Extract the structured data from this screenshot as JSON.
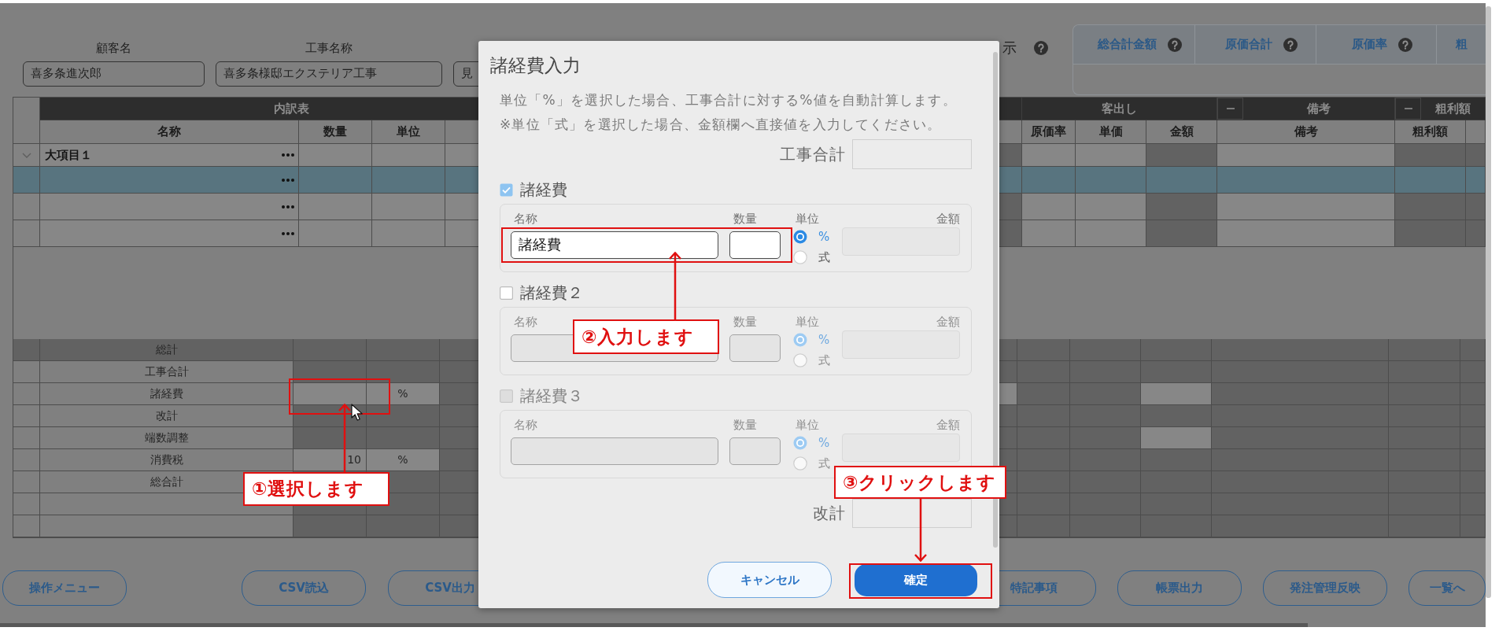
{
  "form": {
    "fields": [
      {
        "label": "顧客名",
        "value": "喜多条進次郎"
      },
      {
        "label": "工事名称",
        "value": "喜多条様邸エクステリア工事"
      },
      {
        "value": "見"
      }
    ],
    "partial_label": "示"
  },
  "summary_panel": {
    "columns": [
      {
        "label": "総合計金額",
        "help": true
      },
      {
        "label": "原価合計",
        "help": true
      },
      {
        "label": "原価率",
        "help": true
      },
      {
        "label": "粗",
        "help": false
      }
    ]
  },
  "table": {
    "column_groups": [
      {
        "label": "内訳表",
        "collapsible": false
      },
      {
        "label": "客出し",
        "collapsible": false
      },
      {
        "label": "備考",
        "collapsible": true,
        "expanded": true
      },
      {
        "label": "粗利額",
        "collapsible": true,
        "expanded": true
      }
    ],
    "columns": [
      {
        "label": "名称",
        "readonly": false
      },
      {
        "label": "数量",
        "readonly": false
      },
      {
        "label": "単位",
        "readonly": false
      },
      {
        "readonly": false
      },
      {
        "readonly": true
      },
      {
        "label": "原価率",
        "readonly": false
      },
      {
        "label": "単価",
        "readonly": false
      },
      {
        "label": "金額",
        "readonly": true
      },
      {
        "label": "備考",
        "readonly": false
      },
      {
        "label": "粗利額",
        "readonly": true
      },
      {
        "readonly": true
      }
    ],
    "rows": [
      {
        "kind": "group",
        "name": "大項目１",
        "expanded": true,
        "selected": false
      },
      {
        "kind": "item",
        "selected": true
      },
      {
        "kind": "item",
        "selected": false
      },
      {
        "kind": "item",
        "selected": false
      }
    ]
  },
  "summary": {
    "rows": [
      {
        "label": "総計",
        "kind": "heading",
        "cells": [
          {
            "editable": false
          },
          {
            "editable": false
          },
          {
            "editable": false
          },
          {
            "editable": false
          },
          {
            "editable": false
          },
          {
            "editable": false
          },
          {
            "editable": false
          },
          {
            "editable": false
          },
          {
            "editable": false
          },
          {
            "editable": false
          }
        ]
      },
      {
        "label": "工事合計",
        "kind": "line",
        "cells": [
          {
            "editable": false
          },
          {
            "editable": false
          },
          {
            "editable": false
          },
          {
            "editable": false
          },
          {
            "editable": false
          },
          {
            "editable": false
          },
          {
            "editable": false
          },
          {
            "editable": false
          },
          {
            "editable": false
          },
          {
            "editable": false
          }
        ]
      },
      {
        "label": "諸経費",
        "kind": "line",
        "cells": [
          {
            "editable": true
          },
          {
            "editable": true,
            "text": "%"
          },
          {
            "editable": false
          },
          {
            "editable": true
          },
          {
            "editable": false
          },
          {
            "editable": false
          },
          {
            "editable": true
          },
          {
            "editable": false
          },
          {
            "editable": false
          },
          {
            "editable": false
          }
        ]
      },
      {
        "label": "改計",
        "kind": "line",
        "cells": [
          {
            "editable": false
          },
          {
            "editable": false
          },
          {
            "editable": false
          },
          {
            "editable": false
          },
          {
            "editable": false
          },
          {
            "editable": false
          },
          {
            "editable": false
          },
          {
            "editable": false
          },
          {
            "editable": false
          },
          {
            "editable": false
          }
        ]
      },
      {
        "label": "端数調整",
        "kind": "line",
        "cells": [
          {
            "editable": false
          },
          {
            "editable": false
          },
          {
            "editable": false
          },
          {
            "editable": false
          },
          {
            "editable": false
          },
          {
            "editable": false
          },
          {
            "editable": true
          },
          {
            "editable": false
          },
          {
            "editable": false
          },
          {
            "editable": false
          }
        ]
      },
      {
        "label": "消費税",
        "kind": "line",
        "cells": [
          {
            "editable": true,
            "text": "10"
          },
          {
            "editable": true,
            "text": "%"
          },
          {
            "editable": false
          },
          {
            "editable": false
          },
          {
            "editable": false
          },
          {
            "editable": false
          },
          {
            "editable": false
          },
          {
            "editable": false
          },
          {
            "editable": false
          },
          {
            "editable": false
          }
        ]
      },
      {
        "label": "総合計",
        "kind": "line",
        "cells": [
          {
            "editable": false
          },
          {
            "editable": false
          },
          {
            "editable": false
          },
          {
            "editable": false
          },
          {
            "editable": false
          },
          {
            "editable": false
          },
          {
            "editable": false
          },
          {
            "editable": false
          },
          {
            "editable": false
          },
          {
            "editable": false
          }
        ]
      },
      {
        "kind": "line",
        "cells": [
          {
            "editable": false
          },
          {
            "editable": false
          },
          {
            "editable": false
          },
          {
            "editable": false
          },
          {
            "editable": false
          },
          {
            "editable": false
          },
          {
            "editable": false
          },
          {
            "editable": false
          },
          {
            "editable": false
          },
          {
            "editable": false
          }
        ]
      },
      {
        "kind": "line",
        "cells": [
          {
            "editable": false
          },
          {
            "editable": false
          },
          {
            "editable": false
          },
          {
            "editable": false
          },
          {
            "editable": false
          },
          {
            "editable": false
          },
          {
            "editable": false
          },
          {
            "editable": false
          },
          {
            "editable": false
          },
          {
            "editable": false
          }
        ]
      }
    ]
  },
  "buttons": [
    {
      "label": "操作メニュー"
    },
    {
      "label": "CSV読込"
    },
    {
      "label": "CSV出力"
    },
    {
      "label": "特記事項"
    },
    {
      "label": "帳票出力"
    },
    {
      "label": "発注管理反映"
    },
    {
      "label": "一覧へ"
    }
  ],
  "dialog": {
    "title": "諸経費入力",
    "notes": [
      "単位「%」を選択した場合、工事合計に対する%値を自動計算します。",
      "※単位「式」を選択した場合、金額欄へ直接値を入力してください。"
    ],
    "subtotal_label": "工事合計",
    "sections": [
      {
        "label": "諸経費",
        "checked": true,
        "disabled": false,
        "name_label": "名称",
        "quantity_label": "数量",
        "unit_label": "単位",
        "amount_label": "金額",
        "name_value": "諸経費",
        "units": [
          {
            "label": "%",
            "selected": true
          },
          {
            "label": "式",
            "selected": false
          }
        ]
      },
      {
        "label": "諸経費２",
        "checked": false,
        "disabled": false,
        "name_label": "名称",
        "quantity_label": "数量",
        "unit_label": "単位",
        "amount_label": "金額",
        "units": [
          {
            "label": "%",
            "selected": true
          },
          {
            "label": "式",
            "selected": false
          }
        ]
      },
      {
        "label": "諸経費３",
        "checked": false,
        "disabled": true,
        "name_label": "名称",
        "quantity_label": "数量",
        "unit_label": "単位",
        "amount_label": "金額",
        "units": [
          {
            "label": "%",
            "selected": true
          },
          {
            "label": "式",
            "selected": false
          }
        ]
      }
    ],
    "revised_total_label": "改計",
    "buttons": [
      {
        "label": "キャンセル",
        "kind": "secondary"
      },
      {
        "label": "確定",
        "kind": "primary"
      }
    ]
  },
  "annotations": [
    {
      "text": "①選択します"
    },
    {
      "text": "②入力します"
    },
    {
      "text": "③クリックします"
    }
  ]
}
